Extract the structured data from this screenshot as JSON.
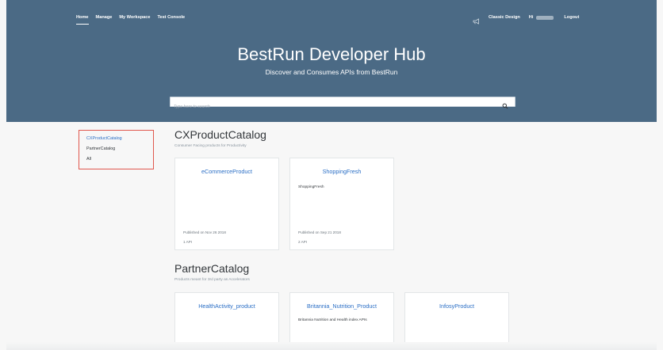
{
  "topnav": {
    "items": [
      {
        "label": "Home",
        "active": true
      },
      {
        "label": "Manage"
      },
      {
        "label": "My Workspace"
      },
      {
        "label": "Test Console"
      }
    ]
  },
  "rightnav": {
    "classic_label": "Classic Design",
    "hi_label": "Hi",
    "logout_label": "Logout",
    "icon": "megaphone-icon"
  },
  "hero": {
    "title": "BestRun Developer Hub",
    "subtitle": "Discover and Consumes APIs from BestRun",
    "bg_color": "#4b6a85"
  },
  "search": {
    "placeholder": "Type here to search",
    "icon": "search-icon"
  },
  "sidebar": {
    "items": [
      {
        "label": "CXProductCatalog",
        "active": true
      },
      {
        "label": "PartnerCatalog"
      },
      {
        "label": "All"
      }
    ],
    "highlight_color": "#e0584e"
  },
  "sections": [
    {
      "title": "CXProductCatalog",
      "description": "Consumer Facing products for Productivity",
      "cards": [
        {
          "title": "eCommerceProduct",
          "description": "",
          "published": "Published on Nov 26 2018",
          "apis": "1 API"
        },
        {
          "title": "ShoppingFresh",
          "description": "ShoppingFresh",
          "published": "Published on Sep 21 2018",
          "apis": "2 API"
        }
      ]
    },
    {
      "title": "PartnerCatalog",
      "description": "Products meant for 3rd party as Accelerators",
      "cards": [
        {
          "title": "HealthActivity_product",
          "description": ""
        },
        {
          "title": "Britannia_Nutrition_Product",
          "description": "Britannia Nutrition and Health index APIs"
        },
        {
          "title": "InfosyProduct",
          "description": ""
        }
      ]
    }
  ],
  "link_color": "#2a6ec5"
}
